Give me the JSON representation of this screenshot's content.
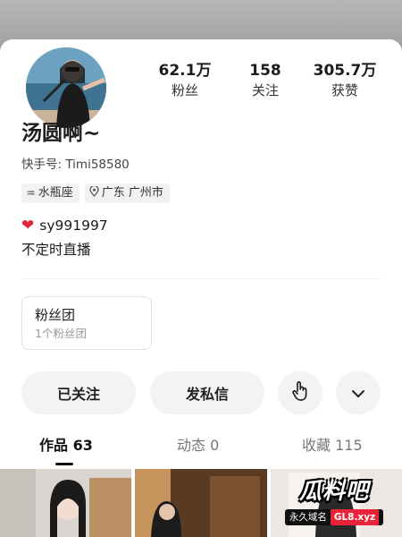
{
  "profile": {
    "name": "汤圆啊~",
    "user_id": "快手号: Timi58580",
    "tags": [
      "水瓶座",
      "广东 广州市"
    ],
    "bio_line1": "sy991997",
    "bio_line2": "不定时直播"
  },
  "stats": [
    {
      "value": "62.1万",
      "label": "粉丝"
    },
    {
      "value": "158",
      "label": "关注"
    },
    {
      "value": "305.7万",
      "label": "获赞"
    }
  ],
  "fan_group": {
    "title": "粉丝团",
    "subtitle": "1个粉丝团"
  },
  "actions": {
    "follow": "已关注",
    "message": "发私信"
  },
  "tabs": [
    {
      "label": "作品 63",
      "active": true
    },
    {
      "label": "动态 0",
      "active": false
    },
    {
      "label": "收藏 115",
      "active": false
    }
  ],
  "watermark": {
    "main": "瓜料吧",
    "prefix": "永久域名",
    "domain": "GL8.xyz"
  },
  "icons": {
    "constellation": "zodiac-icon",
    "location": "location-pin-icon",
    "heart": "red-heart-icon",
    "gesture": "hand-tap-icon",
    "more": "chevron-down-icon"
  },
  "colors": {
    "heart": "#e0243a",
    "background": "#ffffff"
  }
}
